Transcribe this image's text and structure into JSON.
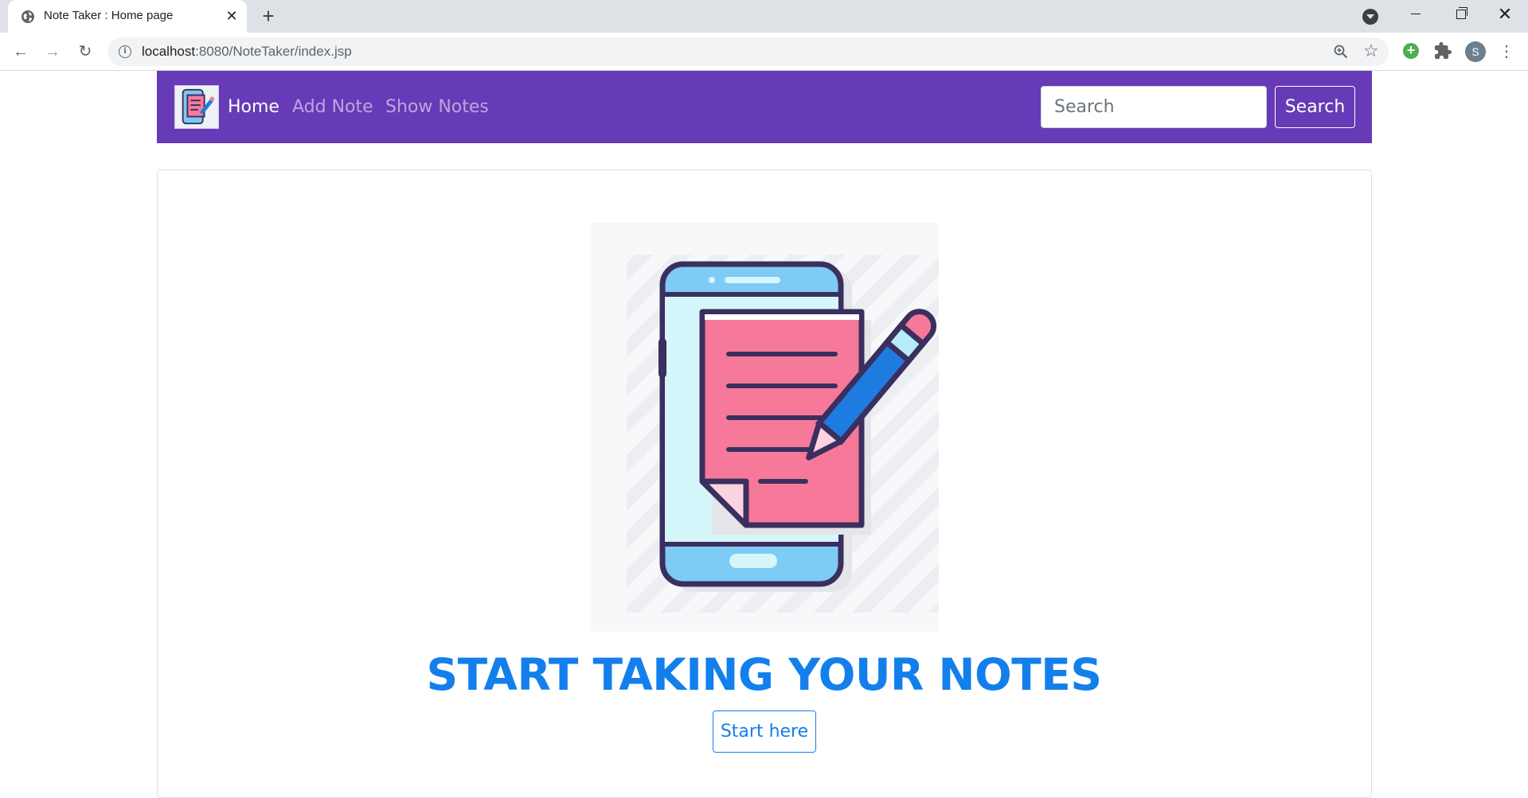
{
  "browser": {
    "tab_title": "Note Taker : Home page",
    "tab_close": "✕",
    "new_tab": "+",
    "url_host": "localhost",
    "url_path": ":8080/NoteTaker/index.jsp",
    "avatar_letter": "S",
    "icons": [
      "globe-icon",
      "close-icon",
      "plus-icon",
      "back-arrow-icon",
      "forward-arrow-icon",
      "reload-icon",
      "info-icon",
      "zoom-icon",
      "star-icon",
      "extension-icon",
      "puzzle-icon",
      "menu-dots-icon"
    ]
  },
  "navbar": {
    "background": "#673ab7",
    "links": [
      {
        "label": "Home"
      },
      {
        "label": "Add Note"
      },
      {
        "label": "Show Notes"
      }
    ],
    "search_placeholder": "Search",
    "search_button": "Search"
  },
  "hero": {
    "title": "START TAKING YOUR NOTES",
    "button": "Start here",
    "accent": "#137fec"
  }
}
